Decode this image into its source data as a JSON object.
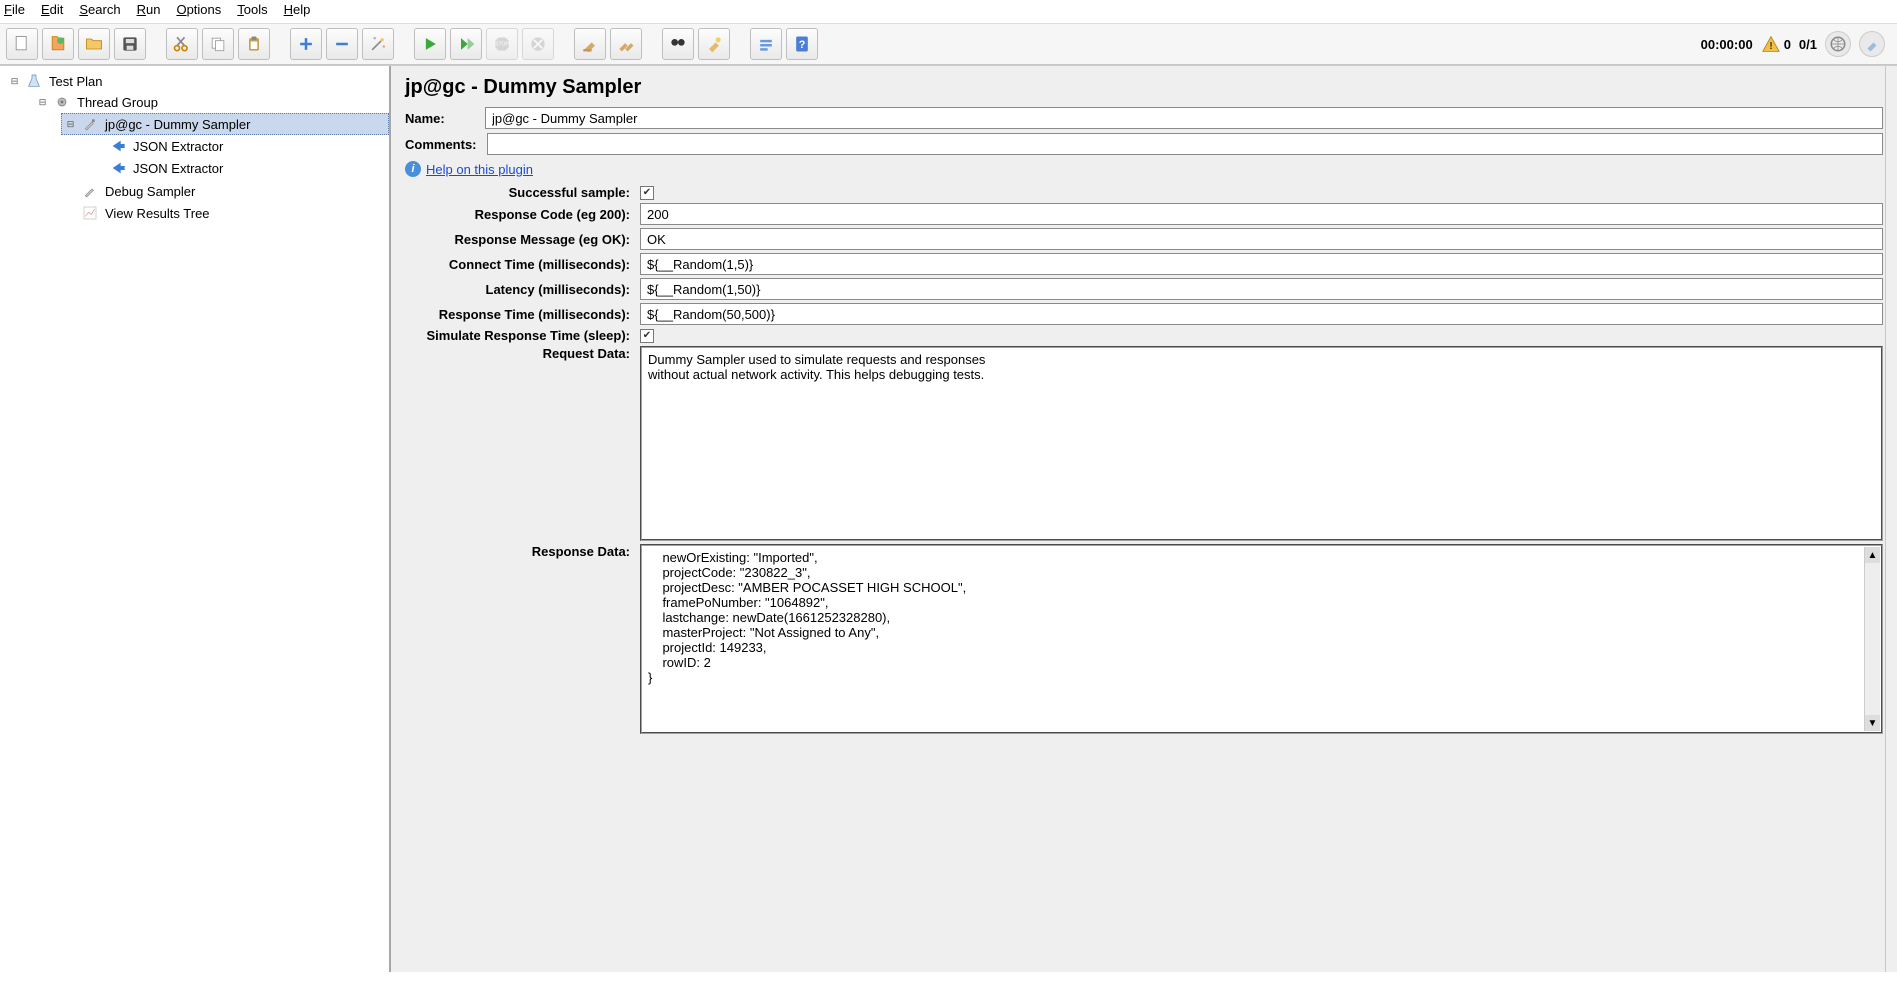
{
  "menubar": {
    "items": [
      "File",
      "Edit",
      "Search",
      "Run",
      "Options",
      "Tools",
      "Help"
    ]
  },
  "toolbar": {
    "buttons": [
      "new",
      "templates",
      "open",
      "save",
      "|",
      "cut",
      "copy",
      "paste",
      "|",
      "add",
      "remove",
      "wand",
      "|",
      "start",
      "start-no-pause",
      "stop",
      "shutdown",
      "|",
      "clear",
      "clear-all",
      "|",
      "search",
      "search-next",
      "|",
      "fn-helper",
      "help"
    ],
    "right": {
      "timer": "00:00:00",
      "warnings": "0",
      "threads": "0/1"
    }
  },
  "tree": {
    "root": {
      "label": "Test Plan",
      "icon": "flask",
      "children": [
        {
          "label": "Thread Group",
          "icon": "gear",
          "children": [
            {
              "label": "jp@gc - Dummy Sampler",
              "icon": "pipette",
              "selected": true,
              "children": [
                {
                  "label": "JSON Extractor",
                  "icon": "arrow-blue"
                },
                {
                  "label": "JSON Extractor",
                  "icon": "arrow-blue"
                }
              ]
            },
            {
              "label": "Debug Sampler",
              "icon": "pipette"
            },
            {
              "label": "View Results Tree",
              "icon": "chart"
            }
          ]
        }
      ]
    }
  },
  "editor": {
    "title": "jp@gc - Dummy Sampler",
    "name_label": "Name:",
    "name_value": "jp@gc - Dummy Sampler",
    "comments_label": "Comments:",
    "comments_value": "",
    "help_link": "Help on this plugin",
    "fields": {
      "successful_label": "Successful sample:",
      "successful_checked": true,
      "response_code_label": "Response Code (eg 200):",
      "response_code_value": "200",
      "response_msg_label": "Response Message (eg OK):",
      "response_msg_value": "OK",
      "connect_time_label": "Connect Time (milliseconds):",
      "connect_time_value": "${__Random(1,5)}",
      "latency_label": "Latency (milliseconds):",
      "latency_value": "${__Random(1,50)}",
      "response_time_label": "Response Time (milliseconds):",
      "response_time_value": "${__Random(50,500)}",
      "simulate_label": "Simulate Response Time (sleep):",
      "simulate_checked": true,
      "request_data_label": "Request Data:",
      "request_data_value": "Dummy Sampler used to simulate requests and responses\nwithout actual network activity. This helps debugging tests.",
      "response_data_label": "Response Data:",
      "response_data_value": "    newOrExisting: \"Imported\",\n    projectCode: \"230822_3\",\n    projectDesc: \"AMBER POCASSET HIGH SCHOOL\",\n    framePoNumber: \"1064892\",\n    lastchange: newDate(1661252328280),\n    masterProject: \"Not Assigned to Any\",\n    projectId: 149233,\n    rowID: 2\n}"
    }
  }
}
